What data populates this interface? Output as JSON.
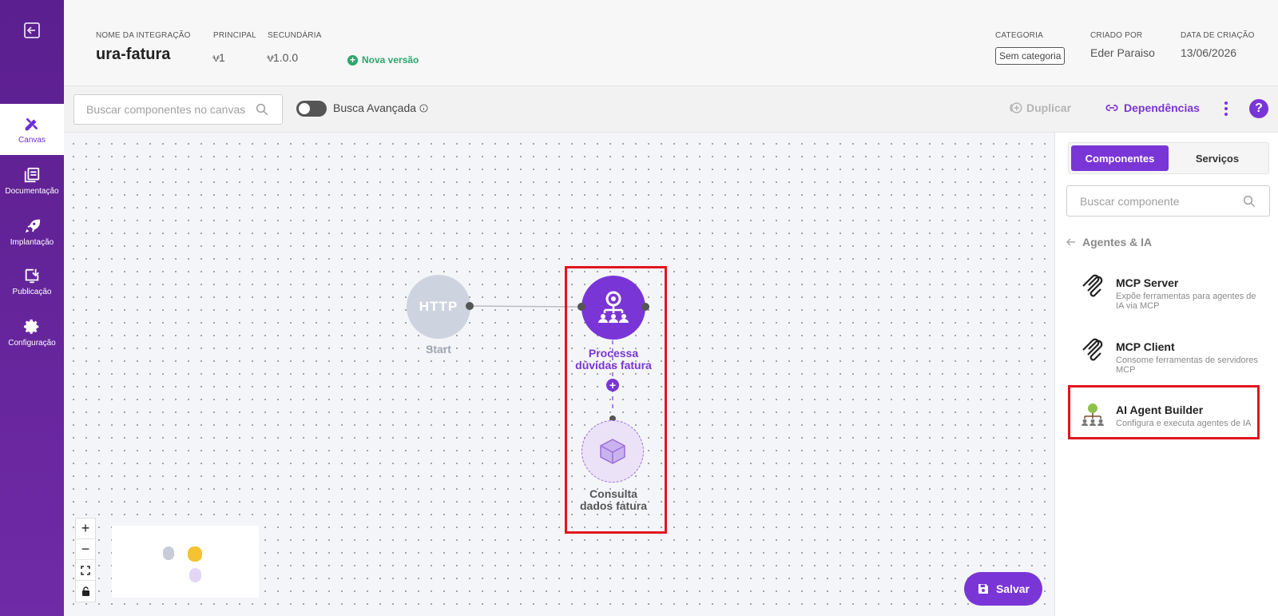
{
  "sidebar": {
    "items": [
      {
        "label": "Canvas",
        "icon": "canvas-pencil-ruler-icon"
      },
      {
        "label": "Documentação",
        "icon": "documentation-icon"
      },
      {
        "label": "Implantação",
        "icon": "rocket-icon"
      },
      {
        "label": "Publicação",
        "icon": "publish-icon"
      },
      {
        "label": "Configuração",
        "icon": "gear-icon"
      }
    ]
  },
  "header": {
    "integration_label": "NOME DA INTEGRAÇÃO",
    "integration_name": "ura-fatura",
    "principal_label": "PRINCIPAL",
    "principal_value": "v1",
    "secundaria_label": "SECUNDÁRIA",
    "secundaria_value": "v1.0.0",
    "nova_versao": "Nova versão",
    "categoria_label": "CATEGORIA",
    "categoria_value": "Sem categoria",
    "criado_por_label": "CRIADO POR",
    "criado_por_value": "Eder Paraiso",
    "data_criacao_label": "DATA DE CRIAÇÃO",
    "data_criacao_value": "13/06/2026"
  },
  "toolbar": {
    "search_placeholder": "Buscar componentes no canvas",
    "busca_avancada": "Busca Avançada",
    "duplicar": "Duplicar",
    "dependencias": "Dependências"
  },
  "canvas": {
    "nodes": [
      {
        "id": "start",
        "badge": "HTTP",
        "label": "Start"
      },
      {
        "id": "processa",
        "label_line1": "Processa",
        "label_line2": "dúvidas fatura"
      },
      {
        "id": "consulta",
        "label_line1": "Consulta",
        "label_line2": "dados fatura"
      }
    ],
    "save_label": "Salvar"
  },
  "panel": {
    "tabs": [
      "Componentes",
      "Serviços"
    ],
    "active_tab": "Componentes",
    "search_placeholder": "Buscar componente",
    "back_label": "Agentes & IA",
    "components": [
      {
        "title": "MCP Server",
        "desc": "Expõe ferramentas para agentes de IA via MCP",
        "icon": "mcp-icon"
      },
      {
        "title": "MCP Client",
        "desc": "Consome ferramentas de servidores MCP",
        "icon": "mcp-icon"
      },
      {
        "title": "AI Agent Builder",
        "desc": "Configura e executa agentes de IA",
        "icon": "agent-builder-icon"
      }
    ]
  },
  "colors": {
    "sidebar": "#6a27a0",
    "accent": "#7a35d6",
    "green": "#2fa56b",
    "highlight": "#e0161d"
  }
}
